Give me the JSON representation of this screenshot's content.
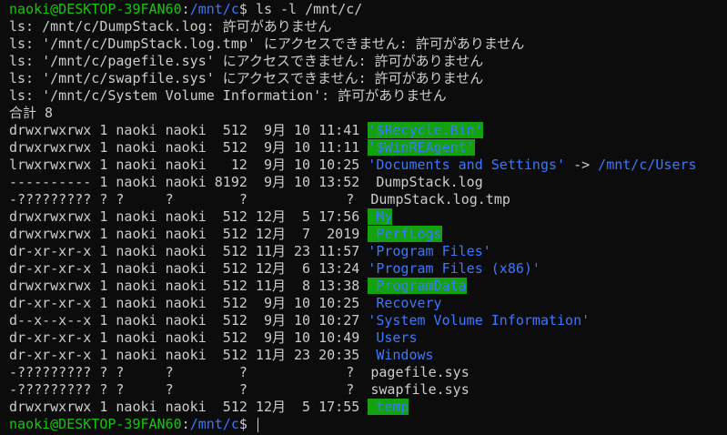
{
  "prompt": {
    "user_host": "naoki@DESKTOP-39FAN60",
    "colon": ":",
    "cwd": "/mnt/c",
    "symbol": "$ ",
    "command": "ls -l /mnt/c/"
  },
  "errors": [
    "ls: /mnt/c/DumpStack.log: 許可がありません",
    "ls: '/mnt/c/DumpStack.log.tmp' にアクセスできません: 許可がありません",
    "ls: '/mnt/c/pagefile.sys' にアクセスできません: 許可がありません",
    "ls: '/mnt/c/swapfile.sys' にアクセスできません: 許可がありません",
    "ls: '/mnt/c/System Volume Information': 許可がありません"
  ],
  "total": "合計 8",
  "entries": [
    {
      "meta": "drwxrwxrwx 1 naoki naoki  512  9月 10 11:41 ",
      "name": "'$Recycle.Bin'",
      "style": "dir-hl"
    },
    {
      "meta": "drwxrwxrwx 1 naoki naoki  512  9月 10 11:11 ",
      "name": "'$WinREAgent'",
      "style": "dir-hl"
    },
    {
      "meta": "lrwxrwxrwx 1 naoki naoki   12  9月 10 10:25 ",
      "name": "'Documents and Settings'",
      "style": "dir",
      "arrow": " -> ",
      "target": "/mnt/c/Users"
    },
    {
      "meta": "---------- 1 naoki naoki 8192  9月 10 13:52 ",
      "name": " DumpStack.log",
      "style": "file"
    },
    {
      "meta": "-????????? ? ?     ?        ?            ? ",
      "name": " DumpStack.log.tmp",
      "style": "file"
    },
    {
      "meta": "drwxrwxrwx 1 naoki naoki  512 12月  5 17:56 ",
      "name": " My",
      "style": "dir-hl"
    },
    {
      "meta": "drwxrwxrwx 1 naoki naoki  512 12月  7  2019 ",
      "name": " PerfLogs",
      "style": "dir-hl"
    },
    {
      "meta": "dr-xr-xr-x 1 naoki naoki  512 11月 23 11:57 ",
      "name": "'Program Files'",
      "style": "dir"
    },
    {
      "meta": "dr-xr-xr-x 1 naoki naoki  512 12月  6 13:24 ",
      "name": "'Program Files (x86)'",
      "style": "dir"
    },
    {
      "meta": "drwxrwxrwx 1 naoki naoki  512 11月  8 13:38 ",
      "name": " ProgramData",
      "style": "dir-hl"
    },
    {
      "meta": "dr-xr-xr-x 1 naoki naoki  512  9月 10 10:25 ",
      "name": " Recovery",
      "style": "dir"
    },
    {
      "meta": "d--x--x--x 1 naoki naoki  512  9月 10 10:27 ",
      "name": "'System Volume Information'",
      "style": "dir"
    },
    {
      "meta": "dr-xr-xr-x 1 naoki naoki  512  9月 10 10:49 ",
      "name": " Users",
      "style": "dir"
    },
    {
      "meta": "dr-xr-xr-x 1 naoki naoki  512 11月 23 20:35 ",
      "name": " Windows",
      "style": "dir"
    },
    {
      "meta": "-????????? ? ?     ?        ?            ? ",
      "name": " pagefile.sys",
      "style": "file"
    },
    {
      "meta": "-????????? ? ?     ?        ?            ? ",
      "name": " swapfile.sys",
      "style": "file"
    },
    {
      "meta": "drwxrwxrwx 1 naoki naoki  512 12月  5 17:55 ",
      "name": " temp",
      "style": "dir-hl"
    }
  ],
  "colors": {
    "background": "#0c0c0c",
    "text": "#cccccc",
    "user": "#16c60c",
    "dir": "#3b78ff",
    "highlight_bg": "#13a10e"
  }
}
